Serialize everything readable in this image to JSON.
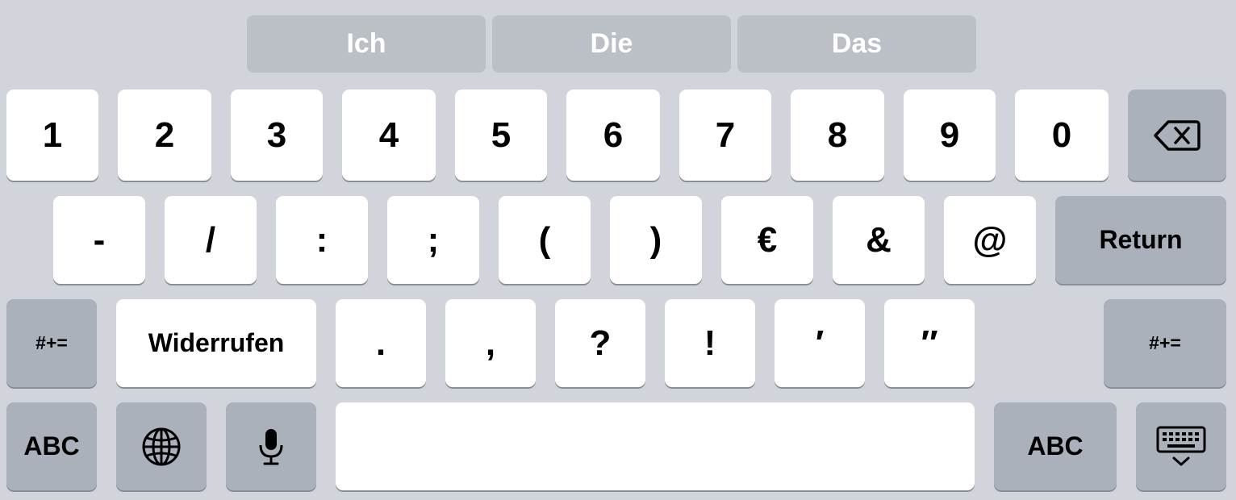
{
  "suggestions": [
    "Ich",
    "Die",
    "Das"
  ],
  "row1": [
    "1",
    "2",
    "3",
    "4",
    "5",
    "6",
    "7",
    "8",
    "9",
    "0"
  ],
  "row2": [
    "-",
    "/",
    ":",
    ";",
    "(",
    ")",
    "€",
    "&",
    "@"
  ],
  "row2_return": "Return",
  "row3": {
    "left_symbols": "#+=",
    "undo": "Widerrufen",
    "punct": [
      ".",
      ",",
      "?",
      "!",
      "′",
      "″"
    ],
    "right_symbols": "#+="
  },
  "row4": {
    "abc_left": "ABC",
    "abc_right": "ABC"
  },
  "icons": {
    "backspace": "backspace-icon",
    "globe": "globe-icon",
    "mic": "microphone-icon",
    "dismiss": "keyboard-dismiss-icon"
  },
  "colors": {
    "background": "#d1d4db",
    "key": "#ffffff",
    "function_key": "#abb1ba",
    "suggestion": "#bbc0c7"
  }
}
